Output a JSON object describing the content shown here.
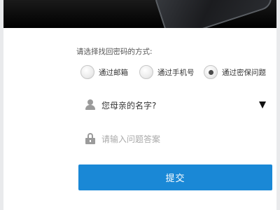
{
  "form": {
    "prompt": "请选择找回密码的方式:",
    "options": [
      {
        "label": "通过邮箱",
        "checked": false
      },
      {
        "label": "通过手机号",
        "checked": false
      },
      {
        "label": "通过密保问题",
        "checked": true
      }
    ],
    "question_select": {
      "value": "您母亲的名字?",
      "icon": "person-icon"
    },
    "answer_input": {
      "placeholder": "请输入问题答案",
      "value": "",
      "icon": "lock-icon"
    },
    "submit_label": "提交"
  },
  "colors": {
    "accent": "#1a88d6",
    "hero_background": "#000000",
    "placeholder_text": "#aaaaaa"
  }
}
